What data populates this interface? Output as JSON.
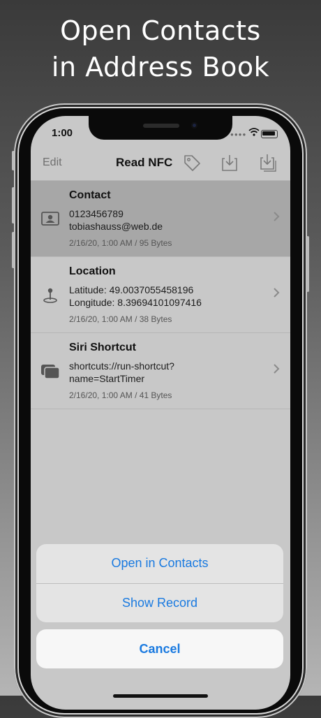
{
  "headline": {
    "line1": "Open Contacts",
    "line2": "in Address Book"
  },
  "status": {
    "time": "1:00"
  },
  "nav": {
    "edit": "Edit",
    "title": "Read NFC"
  },
  "records": [
    {
      "title": "Contact",
      "line1": "0123456789",
      "line2": "tobiashauss@web.de",
      "meta": "2/16/20, 1:00 AM / 95 Bytes",
      "icon": "contact-card-icon"
    },
    {
      "title": "Location",
      "line1": "Latitude: 49.0037055458196",
      "line2": "Longitude: 8.39694101097416",
      "meta": "2/16/20, 1:00 AM / 38 Bytes",
      "icon": "map-pin-icon"
    },
    {
      "title": "Siri Shortcut",
      "line1": "shortcuts://run-shortcut?",
      "line2": "name=StartTimer",
      "meta": "2/16/20, 1:00 AM / 41 Bytes",
      "icon": "shortcut-icon"
    }
  ],
  "sheet": {
    "open_contacts": "Open in Contacts",
    "show_record": "Show Record",
    "cancel": "Cancel"
  },
  "colors": {
    "accent": "#1a7ae0",
    "selected_row": "#a7a7a7"
  }
}
